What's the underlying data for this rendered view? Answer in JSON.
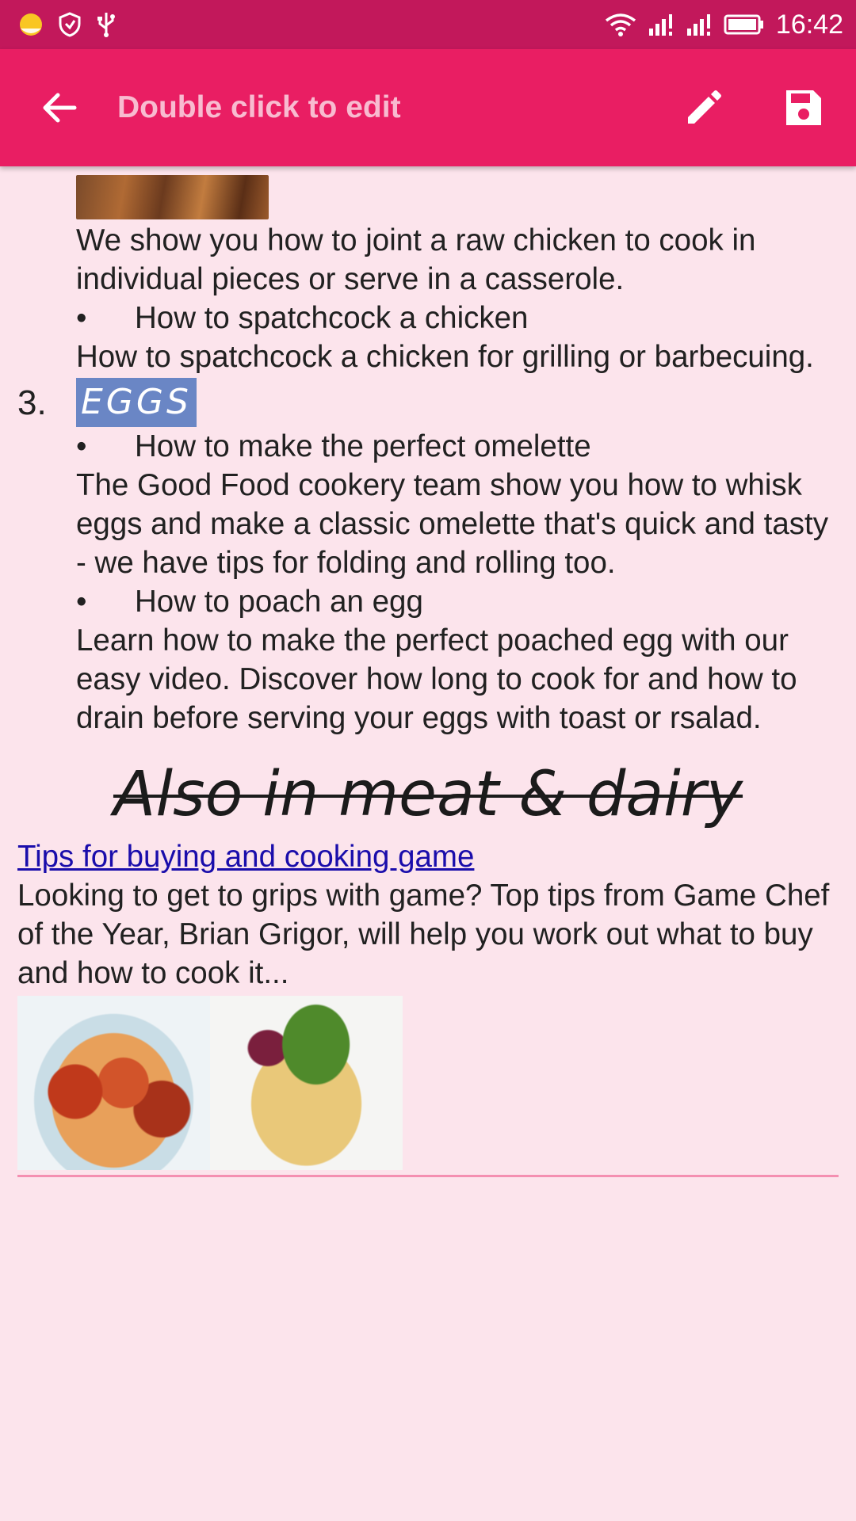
{
  "status_bar": {
    "left_icons": [
      "weather-icon",
      "shield-icon",
      "usb-icon"
    ],
    "right_icons": [
      "wifi-icon",
      "signal-icon",
      "signal-icon",
      "battery-icon"
    ],
    "time": "16:42"
  },
  "app_bar": {
    "title": "Double click to edit",
    "back_icon": "arrow-back-icon",
    "edit_icon": "pencil-icon",
    "save_icon": "save-icon",
    "background": "#e91e63"
  },
  "content": {
    "chicken_joint_desc": "We show you how to joint a raw chicken to cook in individual pieces or serve in a casserole.",
    "bullet_spatchcock": "How to spatchcock a chicken",
    "spatchcock_desc": "How to spatchcock a chicken for grilling or barbecuing.",
    "section3_number": "3.",
    "section3_title": "EGGS",
    "bullet_omelette": "How to make the perfect omelette",
    "omelette_desc": "The Good Food cookery team show you how to whisk eggs and make a classic omelette that's quick and tasty - we have tips for folding and rolling too.",
    "bullet_poach": "How to poach an egg",
    "poach_desc": "Learn how to make the perfect poached egg with our easy video. Discover how long to cook for and how to drain before serving your eggs with toast or rsalad.",
    "also_heading": "Also in meat & dairy",
    "game_link": "Tips for buying and cooking game",
    "game_desc": "Looking to get to grips with game? Top tips from Game Chef of the Year, Brian Grigor, will help you work out what to buy and how to cook it...",
    "bullet_symbol": "•"
  },
  "colors": {
    "status_bar": "#c2185b",
    "page_background": "#fce4ec",
    "title_text": "#f8bbd0",
    "selection": "#6a86c5",
    "link": "#1a0dab",
    "divider": "#f48fb1"
  }
}
